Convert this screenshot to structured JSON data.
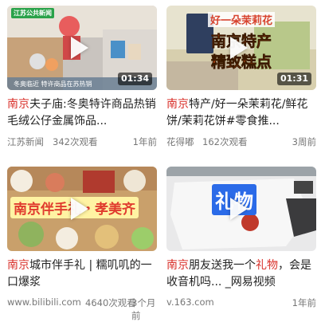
{
  "cards": [
    {
      "title_highlight": "南京",
      "title_rest": "夫子庙:冬奥特许商品热销毛绒公仔金属饰品...",
      "source": "江苏新闻",
      "views": "342次观看",
      "time": "1年前",
      "duration": "01:34",
      "thumb_logo": "江苏公共新闻",
      "thumb_caption": "冬奥临近  特许商品在苏热销"
    },
    {
      "title_highlight": "南京",
      "title_rest": "特产/好一朵茉莉花/鲜花饼/茉莉花饼#零食推...",
      "source": "花得嘟",
      "views": "162次观看",
      "time": "3周前",
      "duration": "01:31",
      "thumb_line1": "好一朵茉莉花",
      "thumb_line2": "南京特产",
      "thumb_line3": "精致糕点"
    },
    {
      "title_highlight": "南京",
      "title_rest": "城市伴手礼 | 糯叽叽的一口爆浆",
      "source": "www.bilibili.com",
      "views": "4640次观看",
      "time": "3个月前",
      "thumb_caption": "南京伴手礼・孝美齐"
    },
    {
      "title_prefix": "南京",
      "title_mid": "朋友送我一个",
      "title_highlight2": "礼物",
      "title_rest": "，会是收音机吗... _网易视频",
      "source": "v.163.com",
      "time": "1年前",
      "thumb_caption": "礼物"
    }
  ],
  "colors": {
    "highlight": "#d9302a",
    "meta": "#777777"
  }
}
